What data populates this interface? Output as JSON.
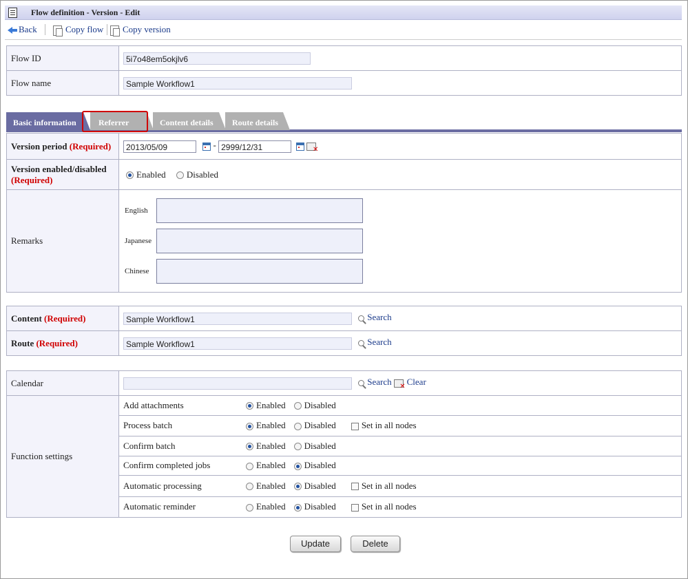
{
  "window": {
    "title": "Flow definition - Version - Edit"
  },
  "toolbar": {
    "back": "Back",
    "copy_flow": "Copy flow",
    "copy_version": "Copy version"
  },
  "flow": {
    "id_label": "Flow ID",
    "id_value": "5i7o48em5okjlv6",
    "name_label": "Flow name",
    "name_value": "Sample Workflow1"
  },
  "tabs": [
    {
      "label": "Basic information",
      "active": true
    },
    {
      "label": "Referrer",
      "active": false
    },
    {
      "label": "Content details",
      "active": false
    },
    {
      "label": "Route details",
      "active": false
    }
  ],
  "version": {
    "period_label": "Version period",
    "required": "(Required)",
    "start_date": "2013/05/09",
    "end_date": "2999/12/31",
    "dash": "-",
    "enabled_label": "Version enabled/disabled",
    "enabled": "Enabled",
    "disabled": "Disabled"
  },
  "remarks": {
    "label": "Remarks",
    "english": "English",
    "japanese": "Japanese",
    "chinese": "Chinese"
  },
  "content": {
    "label": "Content",
    "value": "Sample Workflow1",
    "search": "Search"
  },
  "route": {
    "label": "Route",
    "value": "Sample Workflow1",
    "search": "Search"
  },
  "calendar": {
    "label": "Calendar",
    "value": "",
    "search": "Search",
    "clear": "Clear"
  },
  "functions": {
    "label": "Function settings",
    "enabled": "Enabled",
    "disabled": "Disabled",
    "set_all": "Set in all nodes",
    "rows": [
      {
        "name": "Add attachments",
        "selected": "Enabled",
        "set_all": false
      },
      {
        "name": "Process batch",
        "selected": "Enabled",
        "set_all": true
      },
      {
        "name": "Confirm batch",
        "selected": "Enabled",
        "set_all": false
      },
      {
        "name": "Confirm completed jobs",
        "selected": "Disabled",
        "set_all": false
      },
      {
        "name": "Automatic processing",
        "selected": "Disabled",
        "set_all": true
      },
      {
        "name": "Automatic reminder",
        "selected": "Disabled",
        "set_all": true
      }
    ]
  },
  "buttons": {
    "update": "Update",
    "delete": "Delete"
  }
}
